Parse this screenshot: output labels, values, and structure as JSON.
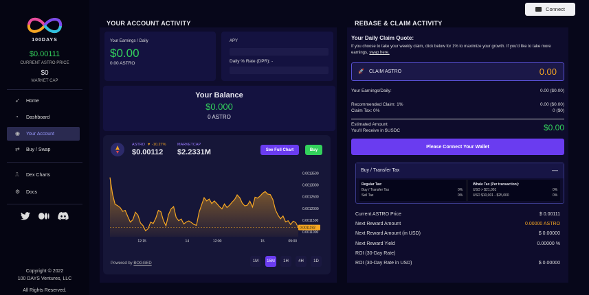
{
  "brand": {
    "name": "100DAYS",
    "price": "$0.00111",
    "price_label": "CURRENT ASTRO PRICE",
    "mcap": "$0",
    "mcap_label": "MARKET CAP"
  },
  "nav": [
    {
      "label": "Home",
      "icon": "rocket-icon"
    },
    {
      "label": "Dashboard",
      "icon": "gauge-icon"
    },
    {
      "label": "Your Account",
      "icon": "user-icon"
    },
    {
      "label": "Buy / Swap",
      "icon": "swap-icon"
    },
    {
      "label": "Dex Charts",
      "icon": "chart-icon"
    },
    {
      "label": "Docs",
      "icon": "docs-icon"
    }
  ],
  "social": [
    "twitter-icon",
    "medium-icon",
    "discord-icon"
  ],
  "footer": {
    "line1": "Copyright © 2022",
    "line2": "100 DAYS Ventures, LLC",
    "line3": "All Rights Reserved."
  },
  "connect": "Connect",
  "account": {
    "title": "YOUR ACCOUNT ACTIVITY",
    "earnings_label": "Your Earnings / Daily",
    "earnings": "$0.00",
    "earnings_astro": "0.00 ASTRO",
    "apy_label": "APY",
    "dpr_label": "Daily % Rate (DPR): -",
    "balance_title": "Your Balance",
    "balance": "$0.000",
    "balance_astro": "0 ASTRO"
  },
  "chart": {
    "token": "ASTRO",
    "change": "▼ -10.27%",
    "price": "$0.00112",
    "mcap_label": "MARKETCAP",
    "mcap": "$2.2331M",
    "full_chart": "See Full Chart",
    "buy": "Buy",
    "powered_prefix": "Powered by ",
    "powered": "BOGGED",
    "current_tag": "0.0011192",
    "timeframes": [
      "1M",
      "15M",
      "1H",
      "4H",
      "1D"
    ],
    "active_tf": "15M"
  },
  "chart_data": {
    "type": "area",
    "x": [
      "12:15",
      "14",
      "12:00",
      "15",
      "09:00"
    ],
    "ylim": [
      0.00108,
      0.00136
    ],
    "yticks": [
      "0.0013500",
      "0.0013000",
      "0.0012500",
      "0.0012000",
      "0.0011500",
      "0.0011000"
    ],
    "values": [
      0.001332,
      0.001262,
      0.001218,
      0.001212,
      0.001204,
      0.001188,
      0.001192,
      0.001166,
      0.001142,
      0.001152,
      0.001184,
      0.001172,
      0.001138,
      0.001127,
      0.001105,
      0.001114,
      0.001142,
      0.001136,
      0.001158,
      0.001192,
      0.001186,
      0.001148,
      0.001126,
      0.001174,
      0.001198,
      0.001208,
      0.001162,
      0.001148,
      0.001155,
      0.001134,
      0.001142,
      0.001147,
      0.00114,
      0.001132,
      0.001128,
      0.001183,
      0.001215,
      0.001246,
      0.001232,
      0.00124,
      0.001221,
      0.001232,
      0.001221,
      0.001208,
      0.001198,
      0.001219,
      0.001204,
      0.001214,
      0.001227,
      0.001238,
      0.001258,
      0.001246,
      0.001223,
      0.001211,
      0.001214,
      0.001231,
      0.001206,
      0.001248,
      0.001244,
      0.001253,
      0.001265,
      0.001272,
      0.001261,
      0.001259,
      0.001238,
      0.001195,
      0.001172,
      0.001156,
      0.001168,
      0.001143,
      0.001148,
      0.001132,
      0.001146,
      0.00114,
      0.001119
    ]
  },
  "rebase": {
    "title": "REBASE & CLAIM ACTIVITY",
    "quote_title": "Your Daily Claim Quote:",
    "quote_text": "If you choose to take your weekly claim, click below for 1% to maximize your growth. If you'd like to take more earnings, ",
    "swap_link": "swap here.",
    "claim_label": "CLAIM ASTRO",
    "claim_value": "0.00",
    "rows": [
      {
        "label": "Your Earnings/Daily:",
        "value": "0.00 ($0.00)"
      },
      {
        "label": "Recommended Claim: 1%",
        "value": "0.00 ($0.00)"
      },
      {
        "label": "Claim Tax: 0%",
        "value": "0 ($0)"
      }
    ],
    "receive_label1": "Estimated Amount",
    "receive_label2": "You'll Receive in $USDC",
    "receive_value": "$0.00",
    "connect_btn": "Please Connect Your Wallet"
  },
  "tax": {
    "title": "Buy / Transfer Tax",
    "toggle": "—",
    "reg_title": "Regular Tax:",
    "reg": [
      {
        "label": "Buy / Transfer Tax",
        "value": "0%"
      },
      {
        "label": "Sell Tax",
        "value": "0%"
      }
    ],
    "whale_title": "Whale Tax (Per transaction):",
    "whale": [
      {
        "label": "USD > $21,001",
        "value": "0%"
      },
      {
        "label": "USD $10,001 - $25,000",
        "value": "0%"
      }
    ]
  },
  "stats": [
    {
      "label": "Current ASTRO Price",
      "value": "$ 0.00111"
    },
    {
      "label": "Next Reward Amount",
      "value": "0.00000 ASTRO",
      "accent": "#f5a623"
    },
    {
      "label": "Next Reward Amount (in USD)",
      "value": "$ 0.00000"
    },
    {
      "label": "Next Reward Yield",
      "value": "0.00000 %"
    },
    {
      "label": "ROI (30-Day Rate)",
      "value": ""
    },
    {
      "label": "ROI (30-Day Rate in USD)",
      "value": "$ 0.00000"
    }
  ]
}
